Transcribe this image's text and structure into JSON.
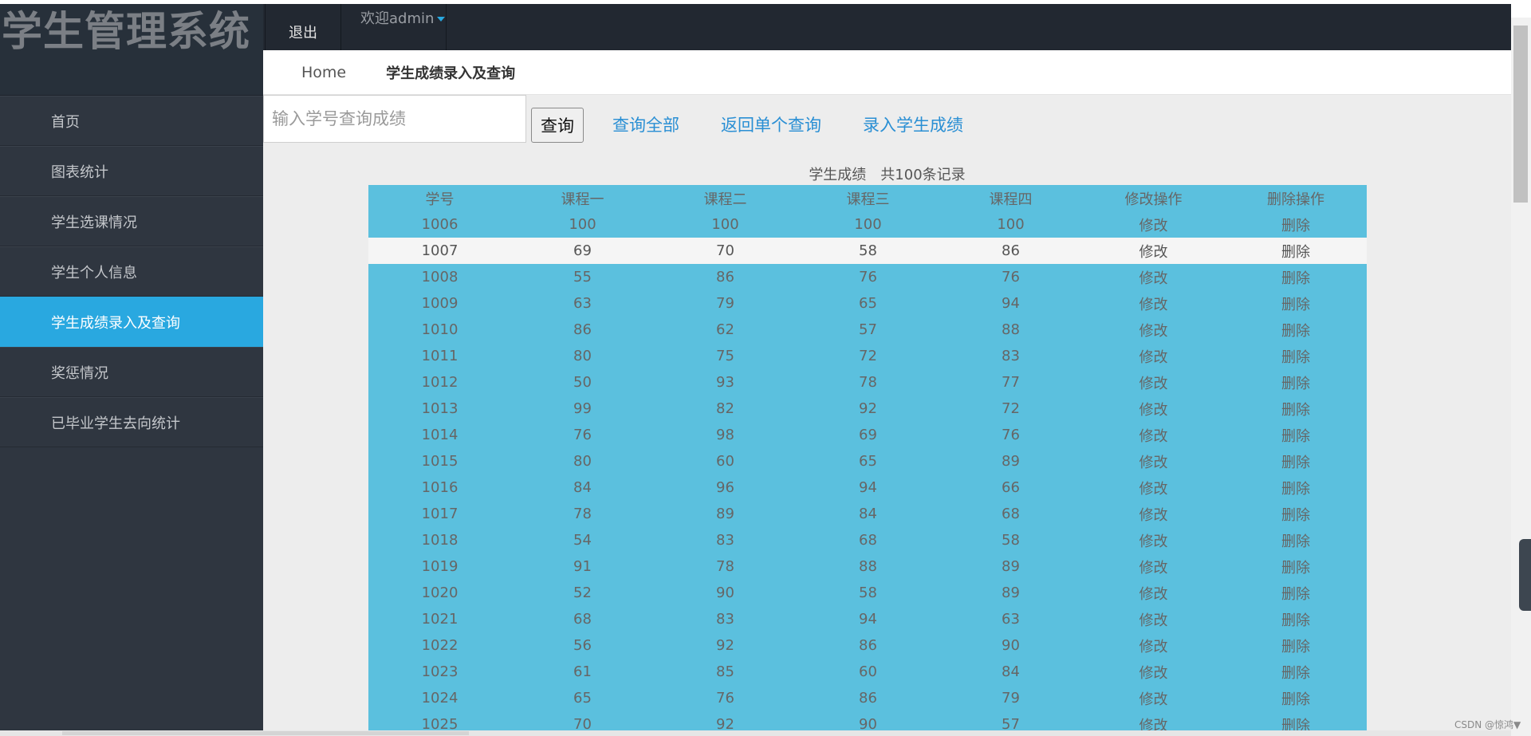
{
  "brand": {
    "title": "学生管理系统"
  },
  "navbar": {
    "logout": "退出",
    "welcome": "欢迎admin"
  },
  "sidebar": {
    "items": [
      {
        "label": "首页"
      },
      {
        "label": "图表统计"
      },
      {
        "label": "学生选课情况"
      },
      {
        "label": "学生个人信息"
      },
      {
        "label": "学生成绩录入及查询"
      },
      {
        "label": "奖惩情况"
      },
      {
        "label": "已毕业学生去向统计"
      }
    ],
    "active_index": 4,
    "active_color": "#29a8e0"
  },
  "breadcrumb": {
    "home": "Home",
    "current": "学生成绩录入及查询"
  },
  "search": {
    "placeholder": "输入学号查询成绩",
    "button": "查询",
    "links": [
      "查询全部",
      "返回单个查询",
      "录入学生成绩"
    ]
  },
  "table": {
    "caption": "学生成绩　共100条记录",
    "headers": [
      "学号",
      "课程一",
      "课程二",
      "课程三",
      "课程四",
      "修改操作",
      "删除操作"
    ],
    "edit_label": "修改",
    "delete_label": "删除",
    "highlight_row": 1,
    "row_color": "#5bc0de",
    "rows": [
      [
        "1006",
        "100",
        "100",
        "100",
        "100"
      ],
      [
        "1007",
        "69",
        "70",
        "58",
        "86"
      ],
      [
        "1008",
        "55",
        "86",
        "76",
        "76"
      ],
      [
        "1009",
        "63",
        "79",
        "65",
        "94"
      ],
      [
        "1010",
        "86",
        "62",
        "57",
        "88"
      ],
      [
        "1011",
        "80",
        "75",
        "72",
        "83"
      ],
      [
        "1012",
        "50",
        "93",
        "78",
        "77"
      ],
      [
        "1013",
        "99",
        "82",
        "92",
        "72"
      ],
      [
        "1014",
        "76",
        "98",
        "69",
        "76"
      ],
      [
        "1015",
        "80",
        "60",
        "65",
        "89"
      ],
      [
        "1016",
        "84",
        "96",
        "94",
        "66"
      ],
      [
        "1017",
        "78",
        "89",
        "84",
        "68"
      ],
      [
        "1018",
        "54",
        "83",
        "68",
        "58"
      ],
      [
        "1019",
        "91",
        "78",
        "88",
        "89"
      ],
      [
        "1020",
        "52",
        "90",
        "58",
        "89"
      ],
      [
        "1021",
        "68",
        "83",
        "94",
        "63"
      ],
      [
        "1022",
        "56",
        "92",
        "86",
        "90"
      ],
      [
        "1023",
        "61",
        "85",
        "60",
        "84"
      ],
      [
        "1024",
        "65",
        "76",
        "86",
        "79"
      ],
      [
        "1025",
        "70",
        "92",
        "90",
        "57"
      ]
    ]
  },
  "watermark": "CSDN @惊鸿▼"
}
